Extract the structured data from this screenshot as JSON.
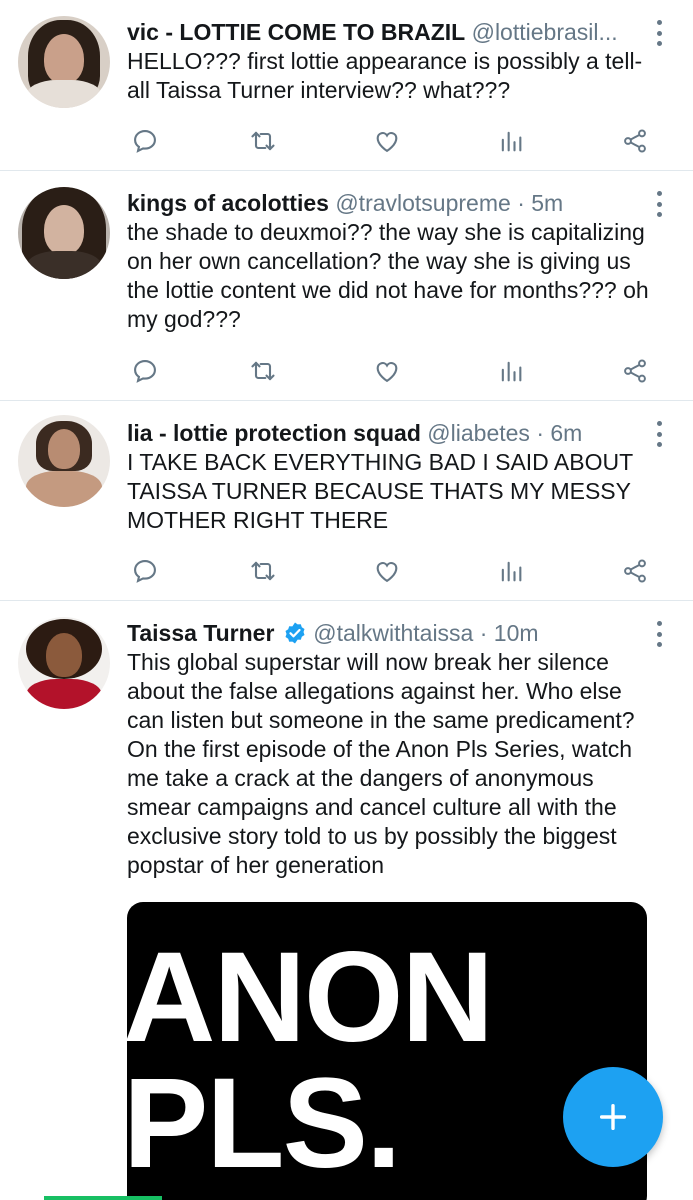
{
  "colors": {
    "accent": "#1da1f2",
    "text": "#14171a",
    "secondary": "#657786",
    "divider": "#e1e8ed"
  },
  "tweets": [
    {
      "name": "vic - LOTTIE COME TO BRAZIL",
      "handle": "@lottiebrasil...",
      "time": "",
      "text": "HELLO??? first lottie appearance is possibly a tell-all Taissa Turner interview?? what???"
    },
    {
      "name": "kings of acolotties",
      "handle": "@travlotsupreme",
      "time": "5m",
      "text": "the shade to deuxmoi?? the way she  is capitalizing on her own cancellation? the way she is giving us the lottie content we did not have for months??? oh my god???"
    },
    {
      "name": "lia - lottie protection squad",
      "handle": "@liabetes",
      "time": "6m",
      "text": "I TAKE BACK EVERYTHING BAD I SAID ABOUT TAISSA TURNER BECAUSE THATS MY MESSY MOTHER RIGHT THERE"
    },
    {
      "name": "Taissa Turner",
      "handle": "@talkwithtaissa",
      "time": "10m",
      "verified": true,
      "text": "This global superstar will now break her silence about the false allegations against her. Who else can listen but someone in the same predicament? On the first episode of the Anon Pls Series, watch me take a crack at the dangers of anonymous smear campaigns and cancel culture  all with the exclusive story told to us by possibly the biggest popstar of her generation",
      "media": {
        "line1": "ANON",
        "line2": "PLS."
      }
    }
  ],
  "separator": "·",
  "action_icons": [
    "reply-icon",
    "retweet-icon",
    "like-icon",
    "analytics-icon",
    "share-icon"
  ],
  "fab": {
    "icon": "plus-icon"
  }
}
